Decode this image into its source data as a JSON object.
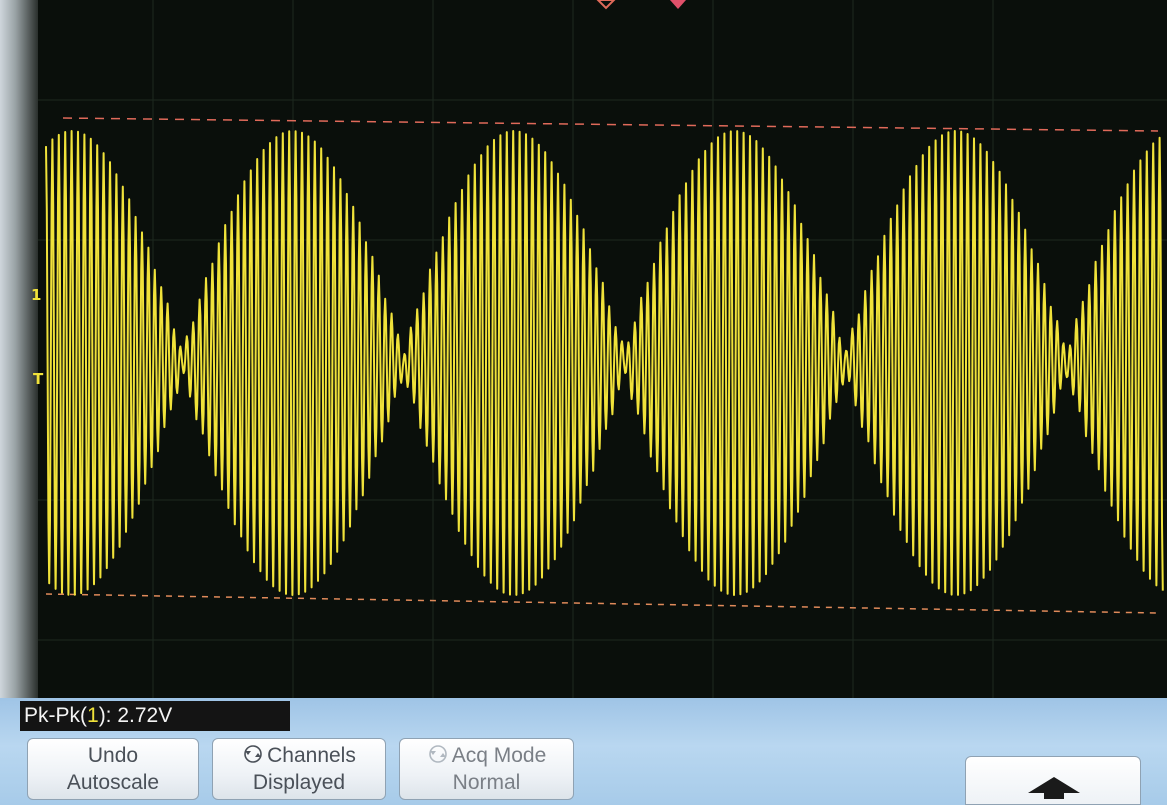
{
  "measurement": {
    "prefix": "Pk-Pk(",
    "channel": "1",
    "suffix": "): 2.72V"
  },
  "markers": {
    "channel1": "1",
    "trigger": "T"
  },
  "softkeys": [
    {
      "line1": "Undo",
      "line2": "Autoscale"
    },
    {
      "line1": "Channels",
      "line2": "Displayed",
      "icon": "rotate-knob-icon"
    },
    {
      "line1": "Acq Mode",
      "line2": "Normal",
      "icon": "rotate-knob-icon",
      "dimmed": true
    }
  ],
  "up_key": {
    "icon": "up-arrow-icon"
  },
  "colors": {
    "trace": "#f0e23a",
    "cursor_lines": "#e06a5a",
    "panel": "#b4d3ee"
  }
}
